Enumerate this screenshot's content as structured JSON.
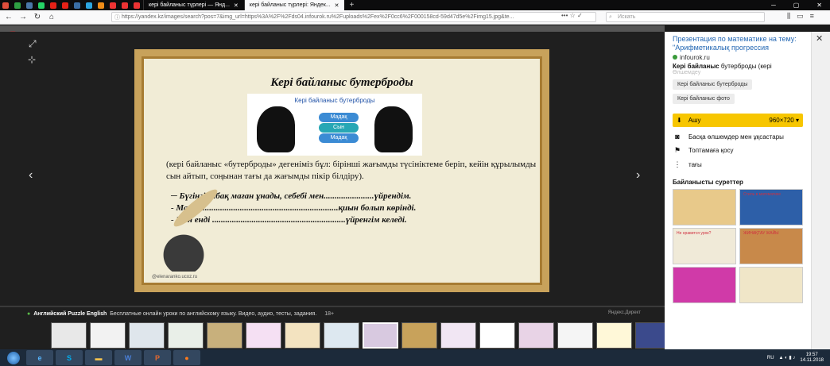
{
  "browser": {
    "tabs": [
      {
        "icon": "sync-icon",
        "color": "#e04e3c",
        "text": ""
      },
      {
        "icon": "mail-icon",
        "color": "#2ea043",
        "text": ""
      },
      {
        "icon": "vk-icon",
        "color": "#4a76a8",
        "text": ""
      },
      {
        "icon": "whatsapp-icon",
        "color": "#25d366",
        "text": ""
      },
      {
        "icon": "youtube-icon",
        "color": "#e62117",
        "text": ""
      },
      {
        "icon": "youtube-icon",
        "color": "#e62117",
        "text": ""
      },
      {
        "icon": "vk-icon",
        "color": "#3a6ea5",
        "text": ""
      },
      {
        "icon": "telegram-icon",
        "color": "#2ca5e0",
        "text": ""
      },
      {
        "icon": "ok-icon",
        "color": "#f08c18",
        "text": ""
      },
      {
        "icon": "yandex-icon",
        "color": "#e33",
        "text": ""
      },
      {
        "icon": "yandex-icon",
        "color": "#e33",
        "text": ""
      },
      {
        "icon": "yandex-icon",
        "color": "#e33",
        "text": ""
      }
    ],
    "text_tabs": [
      {
        "label": "кері байланыс түрлері — Янд...",
        "active": false
      },
      {
        "label": "кері байланыс түрлері: Яндек...",
        "active": true
      }
    ],
    "url": "https://yandex.kz/images/search?pos=7&img_url=https%3A%2F%2Fds04.infourok.ru%2Fuploads%2Fex%2F0cc6%2F000158cd-59d47d5e%2Fimg15.jpg&te...",
    "url_icons": "••• ☆ ✓",
    "search_placeholder": "Искать"
  },
  "viewer": {
    "logo": "Я",
    "slide": {
      "title": "Кері байланыс бутерброды",
      "pic_title": "Кері байланыс бутерброды",
      "bubbles": [
        "Мадақ",
        "Сын",
        "Мадақ"
      ],
      "body": "(кері байланыс «бутерброды» дегеніміз бұл: бірінші жағымды түсініктеме беріп, кейін құрылымды сын айтып, соңынан тағы да жағымды пікір білдіру).",
      "lines": [
        "─ Бүгінгі сабақ маған ұнады, себебі мен.......................үйрендім.",
        "-  Маған...............................................................қиын болып көрінді.",
        " - Мен енді .............................................................үйренгім келеді."
      ],
      "watermark": "@elenaranko.ucoz.ru"
    },
    "ad": {
      "title": "Английский Puzzle English",
      "text": "Бесплатные онлайн уроки по английскому языку. Видео, аудио, тесты, задания.",
      "age": "18+",
      "source": "Яндекс.Директ"
    },
    "thumb_colors": [
      "#e8e8e8",
      "#f2f2f2",
      "#dfe6ec",
      "#e9efe8",
      "#c8b07c",
      "#f5e0f3",
      "#f3e3c0",
      "#dde8f0",
      "#d8c9e0",
      "#c8a25b",
      "#f1e6f3",
      "#ffffff",
      "#e8d3e6",
      "#f5f5f5",
      "#fff8d8",
      "#3b4a8c",
      "#e9f4f9",
      "#f6f1e0",
      "#ffffff",
      "#f0f8f0"
    ]
  },
  "panel": {
    "title": "Презентация по математике на тему: \"Арифметикалық прогрессия",
    "source": "infourok.ru",
    "desc_bold": "Кері байланыс",
    "desc_rest": " бутерброды (кері",
    "desc_more": "Өлшемдеу",
    "chips": [
      "Кері байланыс бутерброды",
      "Кері байланыс фото"
    ],
    "download": "Ашу",
    "size": "960×720",
    "actions": [
      "Басқа өлшемдер мен ұқсастары",
      "Топтамаға қосу",
      "тағы"
    ],
    "similar_header": "Байланысты суреттер",
    "similar_labels": [
      "",
      "Стиль в математике",
      "Не нравится урок?",
      "ЖИНАҚТАУ ЖАЙЫ",
      "",
      ""
    ],
    "similar_colors": [
      "#e8c98a",
      "#2d5fa8",
      "#f0ead8",
      "#c8894a",
      "#d03aa8",
      "#f0e6c8"
    ]
  },
  "taskbar": {
    "apps": [
      "S",
      "",
      "W",
      "P",
      ""
    ],
    "lang": "RU",
    "time": "19:57",
    "date": "14.11.2018"
  }
}
